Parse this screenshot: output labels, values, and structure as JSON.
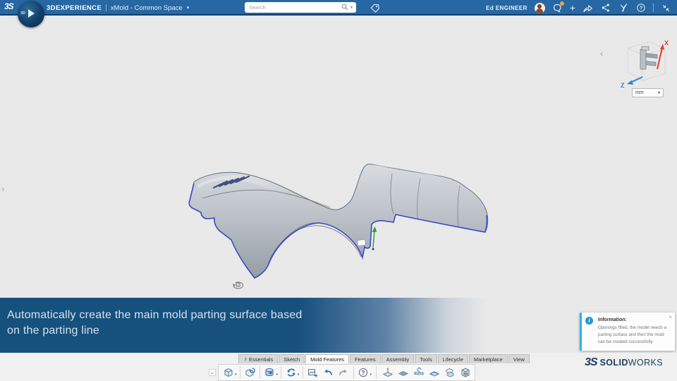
{
  "topbar": {
    "ds_logo": "3S",
    "brand": "3DEXPERIENCE",
    "separator": "|",
    "workspace": "xMold - Common Space",
    "search": {
      "placeholder": "Search"
    },
    "user": "Ed ENGINEER",
    "compass_label": "3D"
  },
  "viewport": {
    "units": "mm",
    "axis_x": "X",
    "axis_z": "Z"
  },
  "banner": {
    "line1": "Automatically create the main mold parting surface based",
    "line2": "on the parting line"
  },
  "info": {
    "title": "Information:",
    "body": "Openings filled, the model needs a parting surface and then the mold can be created successfully.",
    "close": "×",
    "icon_glyph": "i"
  },
  "tabs": [
    {
      "label": "Essentials"
    },
    {
      "label": "Sketch"
    },
    {
      "label": "Mold Features",
      "active": true
    },
    {
      "label": "Features"
    },
    {
      "label": "Assembly"
    },
    {
      "label": "Tools"
    },
    {
      "label": "Lifecycle"
    },
    {
      "label": "Marketplace"
    },
    {
      "label": "View"
    }
  ],
  "glyphs": {
    "caret_down": "▾",
    "plus": "+",
    "help": "?",
    "chev_left": "‹",
    "chev_right": "›",
    "tool_collapse": "⌄"
  },
  "footer": {
    "ds_logo": "3S",
    "logo_bold": "SOLID",
    "logo_light": "WORKS"
  },
  "icons": {
    "topbar": [
      "search-icon",
      "tag-icon",
      "avatar",
      "notifications-icon",
      "add-icon",
      "forward-icon",
      "share-icon",
      "apps-icon",
      "help-icon",
      "collapse-icon"
    ],
    "toolbar_left": [
      "insert-part-icon",
      "part-history-icon",
      "save-icon",
      "update-icon",
      "export-image-icon",
      "undo-icon",
      "redo-icon",
      "help-icon"
    ],
    "toolbar_mold": [
      "parting-line-icon",
      "shutoff-surface-icon",
      "parting-surface-icon",
      "surface-icon",
      "tooling-split-icon",
      "mold-icon"
    ]
  },
  "colors": {
    "topbar_blue": "#2767a3",
    "banner_blue": "#16507d",
    "info_accent": "#2bb3e6",
    "parting_line_blue": "#3646cb",
    "axis_x_red": "#e03c31",
    "axis_z_blue": "#2e86d6"
  }
}
